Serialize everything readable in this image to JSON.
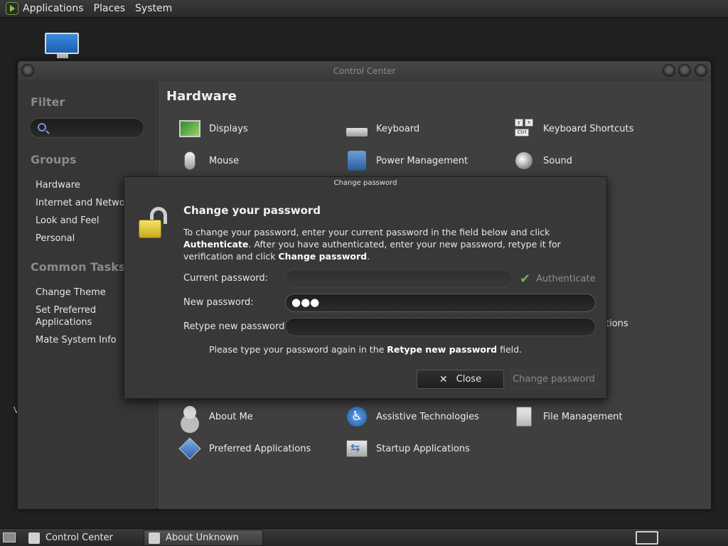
{
  "top_panel": {
    "menus": [
      "Applications",
      "Places",
      "System"
    ]
  },
  "desktop": {
    "stray_text": "V"
  },
  "window": {
    "title": "Control Center",
    "sidebar": {
      "filter_heading": "Filter",
      "groups_heading": "Groups",
      "groups": [
        "Hardware",
        "Internet and Network",
        "Look and Feel",
        "Personal"
      ],
      "tasks_heading": "Common Tasks",
      "tasks": [
        "Change Theme",
        "Set Preferred Applications",
        "Mate System Info"
      ]
    },
    "main": {
      "section_title": "Hardware",
      "hardware_items": [
        {
          "label": "Displays",
          "icon": "displays-icon"
        },
        {
          "label": "Keyboard",
          "icon": "keyboard-icon"
        },
        {
          "label": "Keyboard Shortcuts",
          "icon": "keyboard-shortcuts-icon"
        },
        {
          "label": "Mouse",
          "icon": "mouse-icon"
        },
        {
          "label": "Power Management",
          "icon": "power-management-icon"
        },
        {
          "label": "Sound",
          "icon": "sound-icon"
        }
      ],
      "partial_label": "tions",
      "personal_items": [
        {
          "label": "About Me",
          "icon": "about-me-icon"
        },
        {
          "label": "Assistive Technologies",
          "icon": "assistive-technologies-icon"
        },
        {
          "label": "File Management",
          "icon": "file-management-icon"
        },
        {
          "label": "Preferred Applications",
          "icon": "preferred-applications-icon"
        },
        {
          "label": "Startup Applications",
          "icon": "startup-applications-icon"
        }
      ]
    }
  },
  "dialog": {
    "title": "Change password",
    "heading": "Change your password",
    "description": {
      "p1": "To change your password, enter your current password in the field below and click ",
      "b1": "Authenticate",
      "p2": ". After you have authenticated, enter your new password, retype it for verification and click ",
      "b2": "Change password",
      "p3": "."
    },
    "labels": {
      "current": "Current password:",
      "new": "New password:",
      "retype": "Retype new password:"
    },
    "values": {
      "current": "",
      "new": "●●●",
      "retype": ""
    },
    "authenticate_label": "Authenticate",
    "hint": {
      "p1": "Please type your password again in the ",
      "b1": "Retype new password",
      "p2": " field."
    },
    "close_label": "Close",
    "change_label": "Change password"
  },
  "bottom_panel": {
    "tasks": [
      "Control Center",
      "About Unknown"
    ]
  }
}
